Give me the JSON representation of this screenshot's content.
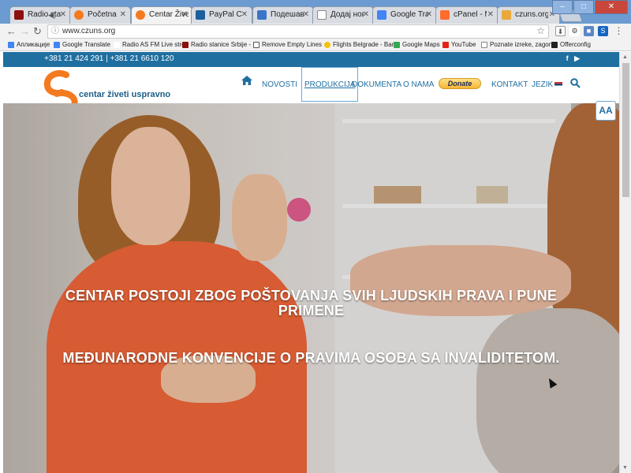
{
  "browser": {
    "tabs": [
      {
        "label": "Radio sta",
        "color": "#8b0f0f"
      },
      {
        "label": "Početna",
        "color": "#f47a20"
      },
      {
        "label": "Centar Živeti",
        "color": "#f47a20"
      },
      {
        "label": "PayPal Chec",
        "color": "#1d5e9c"
      },
      {
        "label": "Подешавањ",
        "color": "#3b75c9"
      },
      {
        "label": "Додај нови",
        "color": "#8a8a8a"
      },
      {
        "label": "Google Trans",
        "color": "#4285f4"
      },
      {
        "label": "cPanel - Ma",
        "color": "#ff6c2c"
      },
      {
        "label": "czuns.org / ",
        "color": "#e8a83a"
      }
    ],
    "window_buttons": {
      "minimize": "–",
      "maximize": "□",
      "close": "✕"
    },
    "url": "www.czuns.org",
    "bookmarks": [
      {
        "label": "Апликације",
        "color": "#4285f4"
      },
      {
        "label": "Google Translate",
        "color": "#4285f4"
      },
      {
        "label": "Radio AS FM Live stre",
        "color": "#888888"
      },
      {
        "label": "Radio stanice Srbije -",
        "color": "#8b0f0f"
      },
      {
        "label": "Remove Empty Lines",
        "color": "#555555"
      },
      {
        "label": "Flights Belgrade - Bar",
        "color": "#f4c20d"
      },
      {
        "label": "Google Maps",
        "color": "#34a853"
      },
      {
        "label": "YouTube",
        "color": "#e62117"
      },
      {
        "label": "Poznate izreke, zagon",
        "color": "#888888"
      },
      {
        "label": "Offerconfig",
        "color": "#222222"
      }
    ]
  },
  "site": {
    "phones": "+381 21 424 291 | +381 21 6610 120",
    "social": {
      "facebook": "f",
      "youtube": "▶"
    },
    "logo_text": "centar živeti uspravno",
    "nav": {
      "novosti": "NOVOSTI",
      "produkcija": "PRODUKCIJA",
      "dokumenta": "DOKUMENTA",
      "o_nama": "O NAMA",
      "donate": "Donate",
      "kontakt": "KONTAKT",
      "jezik": "JEZIK"
    },
    "font_size_button": "AA",
    "hero": {
      "line1": "CENTAR POSTOJI ZBOG POŠTOVANJA SVIH LJUDSKIH PRAVA I PUNE",
      "line2": "PRIMENE",
      "line3": "MEĐUNARODNE KONVENCIJE O PRAVIMA OSOBA SA INVALIDITETOM."
    },
    "colors": {
      "brand_blue": "#1f6fa0",
      "logo_orange": "#f47a20"
    }
  }
}
